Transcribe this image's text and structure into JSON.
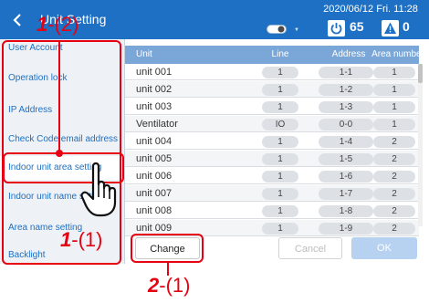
{
  "header": {
    "title": "Unit Setting",
    "datetime": "2020/06/12 Fri. 11:28",
    "power_count": "65",
    "warning_count": "0",
    "icons": [
      "back-chevron-icon",
      "toggle-icon",
      "triangle-down-icon",
      "power-icon",
      "warning-icon"
    ]
  },
  "sidebar": {
    "items": [
      {
        "label": "User Account"
      },
      {
        "label": "Operation lock"
      },
      {
        "label": "IP Address"
      },
      {
        "label": "Check Code email address"
      },
      {
        "label": "Indoor unit area setting"
      },
      {
        "label": "Indoor unit name setting"
      },
      {
        "label": "Area name setting"
      },
      {
        "label": "Backlight"
      }
    ],
    "selected_index": 4
  },
  "table": {
    "columns": [
      "Unit",
      "Line",
      "Address",
      "Area number"
    ],
    "rows": [
      {
        "unit": "unit 001",
        "line": "1",
        "address": "1-1",
        "area": "1"
      },
      {
        "unit": "unit 002",
        "line": "1",
        "address": "1-2",
        "area": "1"
      },
      {
        "unit": "unit 003",
        "line": "1",
        "address": "1-3",
        "area": "1"
      },
      {
        "unit": "Ventilator",
        "line": "IO",
        "address": "0-0",
        "area": "1"
      },
      {
        "unit": "unit 004",
        "line": "1",
        "address": "1-4",
        "area": "2"
      },
      {
        "unit": "unit 005",
        "line": "1",
        "address": "1-5",
        "area": "2"
      },
      {
        "unit": "unit 006",
        "line": "1",
        "address": "1-6",
        "area": "2"
      },
      {
        "unit": "unit 007",
        "line": "1",
        "address": "1-7",
        "area": "2"
      },
      {
        "unit": "unit 008",
        "line": "1",
        "address": "1-8",
        "area": "2"
      },
      {
        "unit": "unit 009",
        "line": "1",
        "address": "1-9",
        "area": "2"
      }
    ]
  },
  "buttons": {
    "change": "Change",
    "cancel": "Cancel",
    "ok": "OK"
  },
  "callouts": {
    "top": {
      "step": "1",
      "sub": "-(2)"
    },
    "sidebar": {
      "step": "1",
      "sub": "-(1)"
    },
    "change": {
      "step": "2",
      "sub": "-(1)"
    }
  },
  "colors": {
    "header_bg": "#1d70c3",
    "table_header_bg": "#7ba7d8",
    "sidebar_text": "#1d70c3",
    "callout": "#e60012",
    "ok_disabled": "#b6d2f0"
  }
}
